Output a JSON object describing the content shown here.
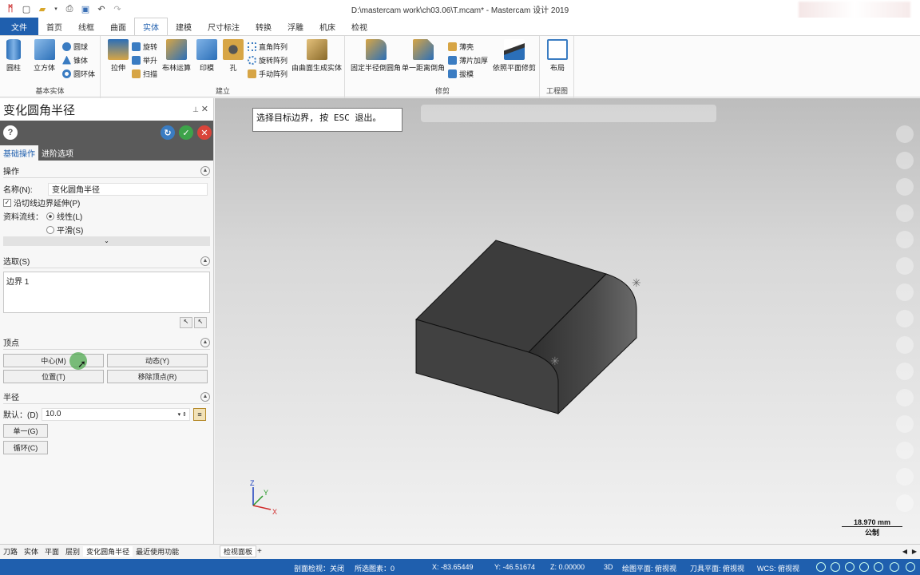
{
  "window": {
    "title": "D:\\mastercam work\\ch03.06\\T.mcam* - Mastercam 设计 2019"
  },
  "quick_access": [
    "app-logo-icon",
    "new-file-icon",
    "open-file-icon",
    "open-dropdown-icon",
    "print-icon",
    "save-as-icon",
    "undo-icon",
    "redo-icon"
  ],
  "ribbon": {
    "tabs": [
      "文件",
      "首页",
      "线框",
      "曲面",
      "实体",
      "建模",
      "尺寸标注",
      "转换",
      "浮雕",
      "机床",
      "检视"
    ],
    "active_tab": "实体",
    "groups": {
      "basic": {
        "label": "基本实体",
        "big": [
          "圆柱",
          "立方体"
        ],
        "small": [
          "圆球",
          "锥体",
          "圆环体"
        ]
      },
      "build": {
        "label": "建立",
        "big": [
          "拉伸",
          "布林运算",
          "印模",
          "孔",
          "由曲面生成实体"
        ],
        "small": [
          "旋转",
          "举升",
          "扫描",
          "直角阵列",
          "旋转阵列",
          "手动阵列"
        ]
      },
      "trim": {
        "label": "修剪",
        "big": [
          "固定半径倒圆角",
          "单一距离倒角",
          "依照平面修剪"
        ],
        "small": [
          "薄壳",
          "薄片加厚",
          "拔模"
        ]
      },
      "drawing": {
        "label": "工程图",
        "big": [
          "布局"
        ]
      }
    }
  },
  "panel": {
    "title": "变化圆角半径",
    "tabs": [
      "基础操作",
      "进阶选项"
    ],
    "operation": {
      "header": "操作",
      "name_label": "名称(N):",
      "name_value": "变化圆角半径",
      "extend_label": "沿切线边界延伸(P)",
      "flow_label": "资料流线：",
      "flow_opt1": "线性(L)",
      "flow_opt2": "平滑(S)"
    },
    "selection": {
      "header": "选取(S)",
      "item": "边界 1"
    },
    "vertex": {
      "header": "顶点",
      "btn_center": "中心(M)",
      "btn_dynamic": "动态(Y)",
      "btn_position": "位置(T)",
      "btn_remove": "移除顶点(R)"
    },
    "radius": {
      "header": "半径",
      "default_label": "默认：(D)",
      "default_value": "10.0",
      "btn_single": "单一(G)",
      "btn_loop": "循环(C)"
    }
  },
  "viewport": {
    "prompt": "选择目标边界, 按 ESC 退出。",
    "axis": {
      "z": "Z",
      "y": "Y",
      "x": "X"
    },
    "scale_value": "18.970 mm",
    "scale_unit": "公制"
  },
  "bottom_tabs": [
    "刀路",
    "实体",
    "平面",
    "层别",
    "变化圆角半径",
    "最近使用功能"
  ],
  "view_tab": "检视面板",
  "status": {
    "section_view": "剖面检视：关闭",
    "selected": "所选图素：0",
    "x": "X: -83.65449",
    "y": "Y: -46.51674",
    "z": "Z: 0.00000",
    "mode": "3D",
    "cplane": "绘图平面: 俯视视",
    "tplane": "刀具平面: 俯视视",
    "wcs": "WCS: 俯视视"
  },
  "colors": {
    "brand": "#1f5fae",
    "dark_panel": "#5a5a5a",
    "solid": "#3c3c3c"
  }
}
